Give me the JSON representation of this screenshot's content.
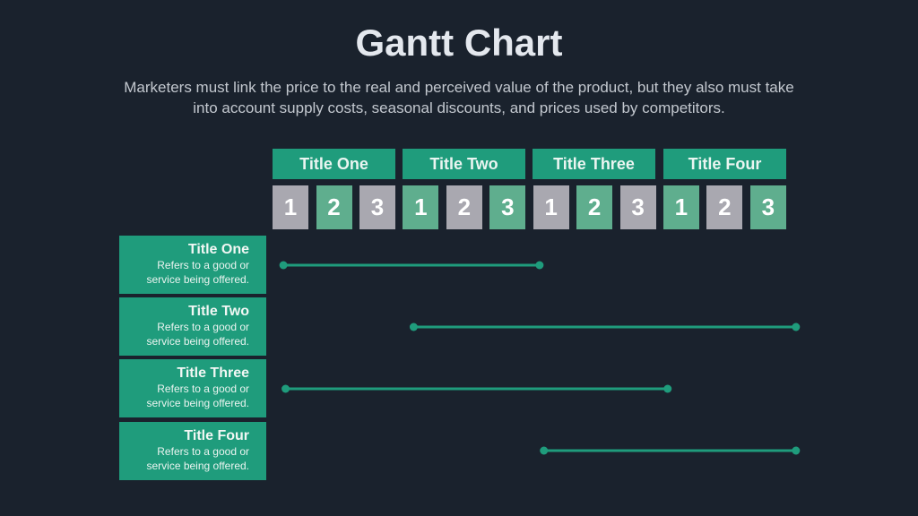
{
  "header": {
    "title": "Gantt Chart",
    "subtitle_line1": "Marketers must link the price to the real and perceived value of the product, but they also must take",
    "subtitle_line2": "into account supply costs, seasonal discounts, and prices used by competitors."
  },
  "chart_data": {
    "type": "gantt",
    "title": "Gantt Chart",
    "bar_color": "#1f9c7c",
    "periods": [
      {
        "label": "Title One",
        "subperiods": [
          "1",
          "2",
          "3"
        ]
      },
      {
        "label": "Title Two",
        "subperiods": [
          "1",
          "2",
          "3"
        ]
      },
      {
        "label": "Title Three",
        "subperiods": [
          "1",
          "2",
          "3"
        ]
      },
      {
        "label": "Title Four",
        "subperiods": [
          "1",
          "2",
          "3"
        ]
      }
    ],
    "subperiod_styles": [
      "s",
      "g",
      "s",
      "g",
      "s",
      "g",
      "s",
      "g",
      "s",
      "g",
      "s",
      "g"
    ],
    "tasks": [
      {
        "title": "Title One",
        "desc1": "Refers to a good or",
        "desc2": "service being offered.",
        "start": 0.25,
        "end": 6.15
      },
      {
        "title": "Title Two",
        "desc1": "Refers to a good or",
        "desc2": "service being offered.",
        "start": 3.25,
        "end": 12.05
      },
      {
        "title": "Title Three",
        "desc1": "Refers to a good or",
        "desc2": "service being offered.",
        "start": 0.3,
        "end": 9.1
      },
      {
        "title": "Title Four",
        "desc1": "Refers to a good or",
        "desc2": "service being offered.",
        "start": 6.25,
        "end": 12.05
      }
    ]
  }
}
